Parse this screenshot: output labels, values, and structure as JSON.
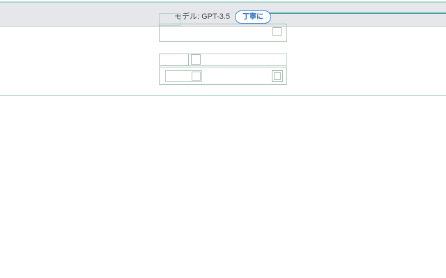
{
  "header": {
    "model_label": "モデル: GPT-3.5",
    "politeness_label": "丁寧に"
  },
  "colors": {
    "header_background": "#e6e7eb",
    "accent_blue": "#3f86d4",
    "accent_teal": "#4aa1a4",
    "outline_green": "#b7d2c3"
  }
}
